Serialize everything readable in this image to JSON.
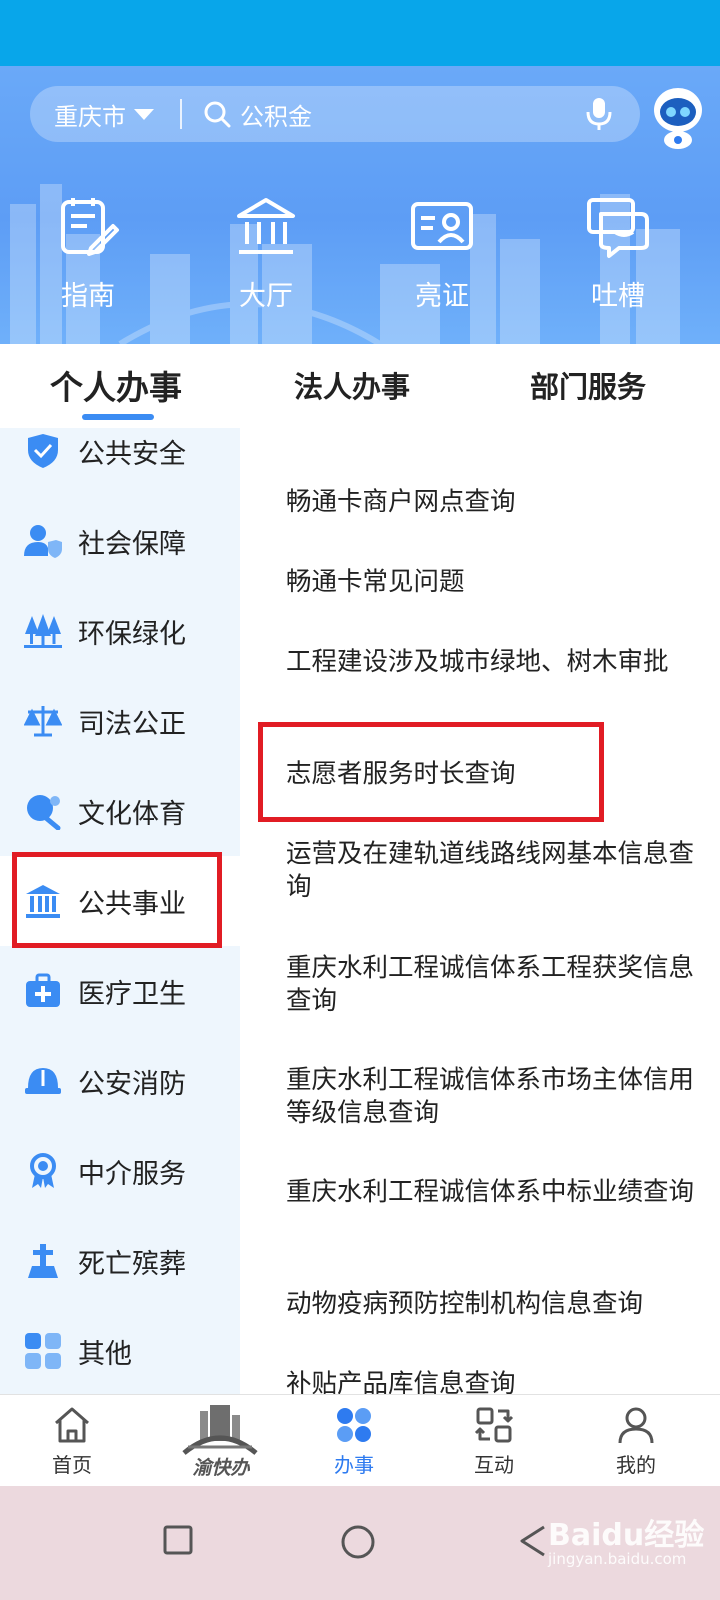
{
  "header": {
    "city": "重庆市",
    "search_placeholder": "公积金"
  },
  "quick_actions": [
    {
      "label": "指南",
      "icon": "guide-icon"
    },
    {
      "label": "大厅",
      "icon": "hall-icon"
    },
    {
      "label": "亮证",
      "icon": "id-card-icon"
    },
    {
      "label": "吐槽",
      "icon": "feedback-icon"
    }
  ],
  "tabs": [
    "个人办事",
    "法人办事",
    "部门服务"
  ],
  "sidebar": {
    "items": [
      {
        "label": "公共安全",
        "icon": "shield-check-icon"
      },
      {
        "label": "社会保障",
        "icon": "user-shield-icon"
      },
      {
        "label": "环保绿化",
        "icon": "trees-icon"
      },
      {
        "label": "司法公正",
        "icon": "scales-icon"
      },
      {
        "label": "文化体育",
        "icon": "ping-pong-icon"
      },
      {
        "label": "公共事业",
        "icon": "public-building-icon"
      },
      {
        "label": "医疗卫生",
        "icon": "medical-kit-icon"
      },
      {
        "label": "公安消防",
        "icon": "helmet-icon"
      },
      {
        "label": "中介服务",
        "icon": "badge-icon"
      },
      {
        "label": "死亡殡葬",
        "icon": "memorial-icon"
      },
      {
        "label": "其他",
        "icon": "grid-icon"
      }
    ],
    "active": "公共事业"
  },
  "services": [
    "畅通卡商户网点查询",
    "畅通卡常见问题",
    "工程建设涉及城市绿地、树木审批",
    "志愿者服务时长查询",
    "运营及在建轨道线路线网基本信息查询",
    "重庆水利工程诚信体系工程获奖信息查询",
    "重庆水利工程诚信体系市场主体信用等级信息查询",
    "重庆水利工程诚信体系中标业绩查询",
    "动物疫病预防控制机构信息查询",
    "补贴产品库信息查询"
  ],
  "bottom_nav": [
    {
      "label": "首页",
      "icon": "home-icon"
    },
    {
      "label": "",
      "icon": "brand-logo-icon"
    },
    {
      "label": "办事",
      "icon": "services-icon"
    },
    {
      "label": "互动",
      "icon": "interaction-icon"
    },
    {
      "label": "我的",
      "icon": "profile-icon"
    }
  ],
  "brand_text": "渝快办",
  "watermark": {
    "main": "Baidu经验",
    "sub": "jingyan.baidu.com"
  },
  "colors": {
    "accent": "#3b8cf3",
    "highlight": "#e11c24",
    "hero": "#5d9df5",
    "status": "#08a6ea"
  }
}
